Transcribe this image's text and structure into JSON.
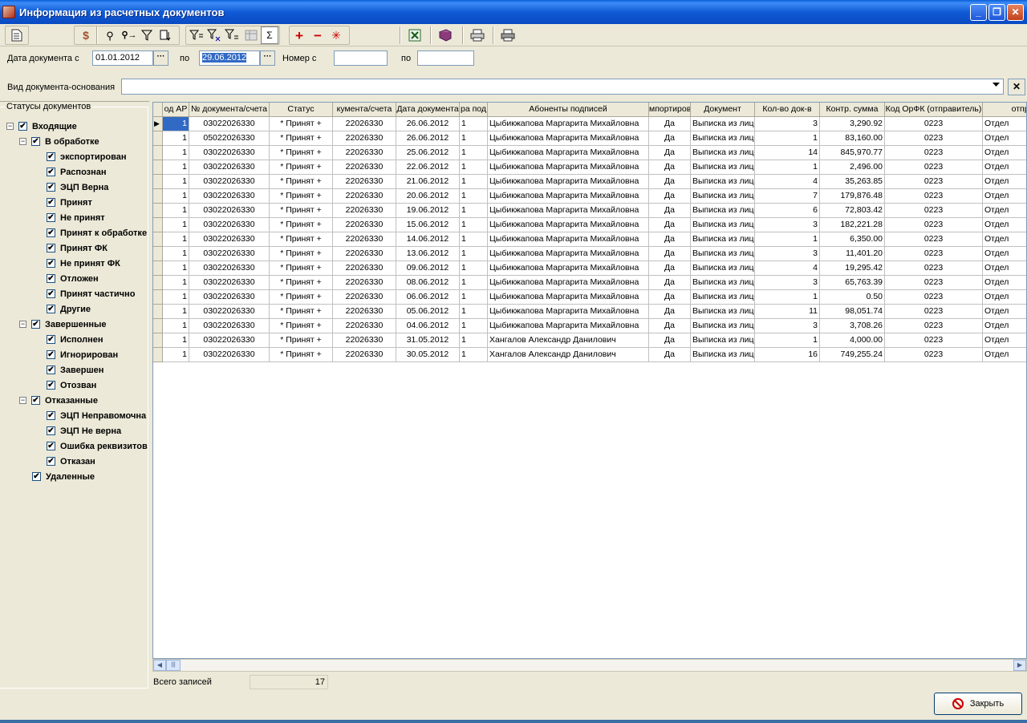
{
  "window": {
    "title": "Информация из расчетных документов",
    "minimize": "_",
    "restore": "❐",
    "close": "✕"
  },
  "toolbar": {
    "icons": [
      "document-icon",
      "money-icon",
      "binoculars-icon",
      "find-next-icon",
      "filter-icon",
      "copy-filter-icon",
      "filter-equals-icon",
      "filter-x-icon",
      "filter-y-icon",
      "table-disabled-icon",
      "sum-icon",
      "add-icon",
      "remove-icon",
      "asterisk-icon",
      "excel-icon",
      "book-icon",
      "print-icon",
      "print-preview-icon"
    ],
    "sum_label": "Σ",
    "add_label": "+",
    "remove_label": "−",
    "star_label": "✳"
  },
  "filter": {
    "date_from_label": "Дата документа с",
    "date_from": "01.01.2012",
    "date_to_label": "по",
    "date_to": "29.06.2012",
    "number_from_label": "Номер с",
    "number_from": "",
    "number_to_label": "по",
    "number_to": "",
    "doc_type_label": "Вид документа-основания",
    "doc_type": "",
    "dots": "···",
    "clear": "✕"
  },
  "tree": {
    "title": "Статусы документов",
    "nodes": [
      {
        "label": "Входящие",
        "level": 0,
        "expander": "−"
      },
      {
        "label": "В обработке",
        "level": 1,
        "expander": "−"
      },
      {
        "label": "экспортирован",
        "level": 2
      },
      {
        "label": "Распознан",
        "level": 2
      },
      {
        "label": "ЭЦП Верна",
        "level": 2
      },
      {
        "label": "Принят",
        "level": 2
      },
      {
        "label": "Не принят",
        "level": 2
      },
      {
        "label": "Принят к обработке",
        "level": 2
      },
      {
        "label": "Принят ФК",
        "level": 2
      },
      {
        "label": "Не принят ФК",
        "level": 2
      },
      {
        "label": "Отложен",
        "level": 2
      },
      {
        "label": "Принят частично",
        "level": 2
      },
      {
        "label": "Другие",
        "level": 2
      },
      {
        "label": "Завершенные",
        "level": 1,
        "expander": "−"
      },
      {
        "label": "Исполнен",
        "level": 2
      },
      {
        "label": "Игнорирован",
        "level": 2
      },
      {
        "label": "Завершен",
        "level": 2
      },
      {
        "label": "Отозван",
        "level": 2
      },
      {
        "label": "Отказанные",
        "level": 1,
        "expander": "−"
      },
      {
        "label": "ЭЦП Неправомочна",
        "level": 2
      },
      {
        "label": "ЭЦП Не верна",
        "level": 2
      },
      {
        "label": "Ошибка реквизитов",
        "level": 2
      },
      {
        "label": "Отказан",
        "level": 2
      },
      {
        "label": "Удаленные",
        "level": 1
      }
    ],
    "check": "✔"
  },
  "grid": {
    "columns": [
      "од АР",
      "№ документа/счета",
      "Статус",
      "кумента/счета",
      "Дата документа",
      "ра под",
      "Абоненты подписей",
      "мпортиров",
      "Документ",
      "Кол-во док-в",
      "Контр. сумма",
      "Код ОрФК (отправитель)",
      "отпра"
    ],
    "rows": [
      [
        "1",
        "03022026330",
        "* Принят +",
        "22026330",
        "26.06.2012",
        "1",
        "Цыбикжапова Маргарита Михайловна",
        "Да",
        "Выписка из лицевого счета",
        "3",
        "3,290.92",
        "0223",
        "Отдел"
      ],
      [
        "1",
        "05022026330",
        "* Принят +",
        "22026330",
        "26.06.2012",
        "1",
        "Цыбикжапова Маргарита Михайловна",
        "Да",
        "Выписка из лицевого счета",
        "1",
        "83,160.00",
        "0223",
        "Отдел"
      ],
      [
        "1",
        "03022026330",
        "* Принят +",
        "22026330",
        "25.06.2012",
        "1",
        "Цыбикжапова Маргарита Михайловна",
        "Да",
        "Выписка из лицевого счета",
        "14",
        "845,970.77",
        "0223",
        "Отдел"
      ],
      [
        "1",
        "03022026330",
        "* Принят +",
        "22026330",
        "22.06.2012",
        "1",
        "Цыбикжапова Маргарита Михайловна",
        "Да",
        "Выписка из лицевого счета",
        "1",
        "2,496.00",
        "0223",
        "Отдел"
      ],
      [
        "1",
        "03022026330",
        "* Принят +",
        "22026330",
        "21.06.2012",
        "1",
        "Цыбикжапова Маргарита Михайловна",
        "Да",
        "Выписка из лицевого счета",
        "4",
        "35,263.85",
        "0223",
        "Отдел"
      ],
      [
        "1",
        "03022026330",
        "* Принят +",
        "22026330",
        "20.06.2012",
        "1",
        "Цыбикжапова Маргарита Михайловна",
        "Да",
        "Выписка из лицевого счета",
        "7",
        "179,876.48",
        "0223",
        "Отдел"
      ],
      [
        "1",
        "03022026330",
        "* Принят +",
        "22026330",
        "19.06.2012",
        "1",
        "Цыбикжапова Маргарита Михайловна",
        "Да",
        "Выписка из лицевого счета",
        "6",
        "72,803.42",
        "0223",
        "Отдел"
      ],
      [
        "1",
        "03022026330",
        "* Принят +",
        "22026330",
        "15.06.2012",
        "1",
        "Цыбикжапова Маргарита Михайловна",
        "Да",
        "Выписка из лицевого счета",
        "3",
        "182,221.28",
        "0223",
        "Отдел"
      ],
      [
        "1",
        "03022026330",
        "* Принят +",
        "22026330",
        "14.06.2012",
        "1",
        "Цыбикжапова Маргарита Михайловна",
        "Да",
        "Выписка из лицевого счета",
        "1",
        "6,350.00",
        "0223",
        "Отдел"
      ],
      [
        "1",
        "03022026330",
        "* Принят +",
        "22026330",
        "13.06.2012",
        "1",
        "Цыбикжапова Маргарита Михайловна",
        "Да",
        "Выписка из лицевого счета",
        "3",
        "11,401.20",
        "0223",
        "Отдел"
      ],
      [
        "1",
        "03022026330",
        "* Принят +",
        "22026330",
        "09.06.2012",
        "1",
        "Цыбикжапова Маргарита Михайловна",
        "Да",
        "Выписка из лицевого счета",
        "4",
        "19,295.42",
        "0223",
        "Отдел"
      ],
      [
        "1",
        "03022026330",
        "* Принят +",
        "22026330",
        "08.06.2012",
        "1",
        "Цыбикжапова Маргарита Михайловна",
        "Да",
        "Выписка из лицевого счета",
        "3",
        "65,763.39",
        "0223",
        "Отдел"
      ],
      [
        "1",
        "03022026330",
        "* Принят +",
        "22026330",
        "06.06.2012",
        "1",
        "Цыбикжапова Маргарита Михайловна",
        "Да",
        "Выписка из лицевого счета",
        "1",
        "0.50",
        "0223",
        "Отдел"
      ],
      [
        "1",
        "03022026330",
        "* Принят +",
        "22026330",
        "05.06.2012",
        "1",
        "Цыбикжапова Маргарита Михайловна",
        "Да",
        "Выписка из лицевого счета",
        "11",
        "98,051.74",
        "0223",
        "Отдел"
      ],
      [
        "1",
        "03022026330",
        "* Принят +",
        "22026330",
        "04.06.2012",
        "1",
        "Цыбикжапова Маргарита Михайловна",
        "Да",
        "Выписка из лицевого счета",
        "3",
        "3,708.26",
        "0223",
        "Отдел"
      ],
      [
        "1",
        "03022026330",
        "* Принят +",
        "22026330",
        "31.05.2012",
        "1",
        "Хангалов Александр Данилович",
        "Да",
        "Выписка из лицевого счета",
        "1",
        "4,000.00",
        "0223",
        "Отдел"
      ],
      [
        "1",
        "03022026330",
        "* Принят +",
        "22026330",
        "30.05.2012",
        "1",
        "Хангалов Александр Данилович",
        "Да",
        "Выписка из лицевого счета",
        "16",
        "749,255.24",
        "0223",
        "Отдел"
      ]
    ],
    "row_pointer": "▶"
  },
  "scroll": {
    "left": "◀",
    "right": "▶",
    "thumb": "|||"
  },
  "status": {
    "total_label": "Всего записей",
    "total_value": "17"
  },
  "buttons": {
    "close": "Закрыть"
  }
}
